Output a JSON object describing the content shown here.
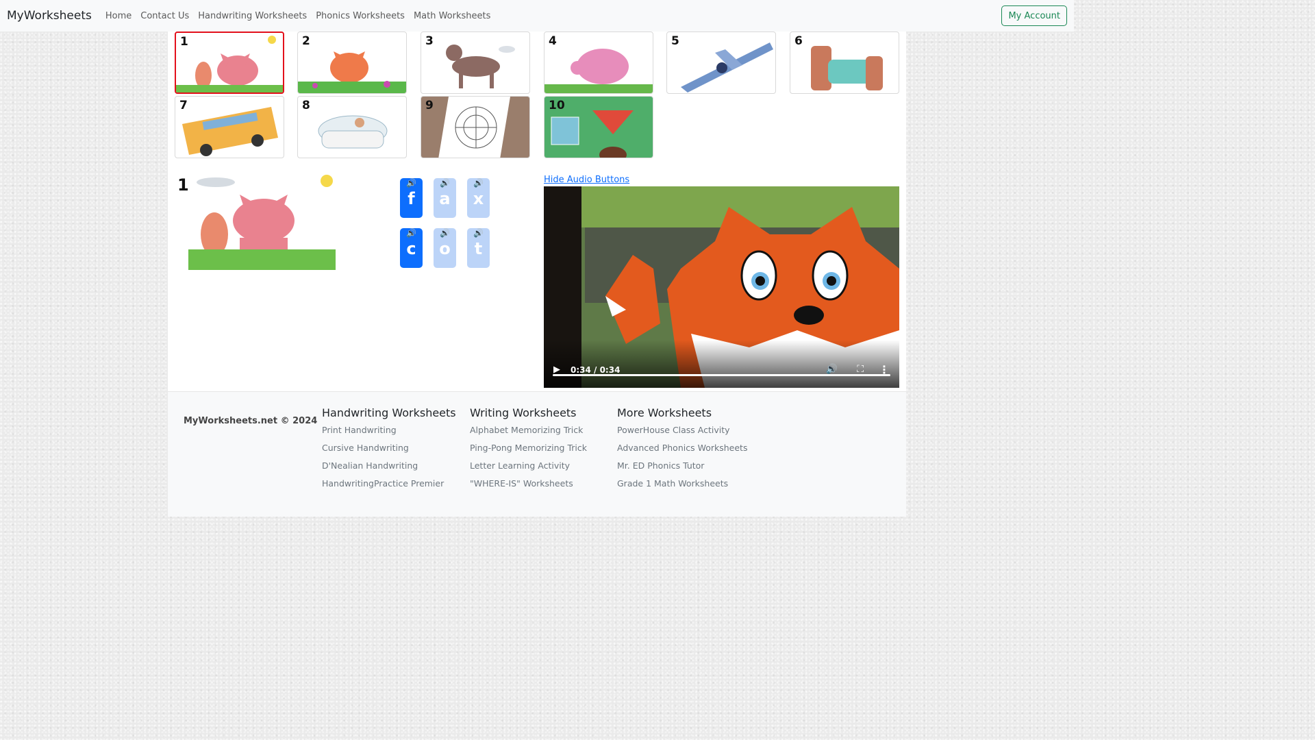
{
  "nav": {
    "brand": "MyWorksheets",
    "links": [
      "Home",
      "Contact Us",
      "Handwriting Worksheets",
      "Phonics Worksheets",
      "Math Worksheets"
    ],
    "account": "My Account"
  },
  "thumbnails": [
    {
      "num": "1",
      "subject": "cat",
      "selected": true
    },
    {
      "num": "2",
      "subject": "cat"
    },
    {
      "num": "3",
      "subject": "dog"
    },
    {
      "num": "4",
      "subject": "pig"
    },
    {
      "num": "5",
      "subject": "jet"
    },
    {
      "num": "6",
      "subject": "bed"
    },
    {
      "num": "7",
      "subject": "bus"
    },
    {
      "num": "8",
      "subject": "tub"
    },
    {
      "num": "9",
      "subject": "web"
    },
    {
      "num": "10",
      "subject": "top"
    }
  ],
  "preview": {
    "num": "1"
  },
  "letters": [
    {
      "char": "f",
      "active": true
    },
    {
      "char": "a",
      "active": false
    },
    {
      "char": "x",
      "active": false
    },
    {
      "char": "c",
      "active": true
    },
    {
      "char": "o",
      "active": false
    },
    {
      "char": "t",
      "active": false
    }
  ],
  "speaker_icon": "🔊",
  "hide_audio_link": "Hide Audio Buttons",
  "video": {
    "time": "0:34 / 0:34",
    "progress": 1.0
  },
  "footer": {
    "copyright": "MyWorksheets.net © 2024",
    "columns": [
      {
        "title": "Handwriting Worksheets",
        "links": [
          "Print Handwriting",
          "Cursive Handwriting",
          "D'Nealian Handwriting",
          "HandwritingPractice Premier"
        ]
      },
      {
        "title": "Writing Worksheets",
        "links": [
          "Alphabet Memorizing Trick",
          "Ping-Pong Memorizing Trick",
          "Letter Learning Activity",
          "\"WHERE-IS\" Worksheets"
        ]
      },
      {
        "title": "More Worksheets",
        "links": [
          "PowerHouse Class Activity",
          "Advanced Phonics Worksheets",
          "Mr. ED Phonics Tutor",
          "Grade 1 Math Worksheets"
        ]
      }
    ]
  }
}
